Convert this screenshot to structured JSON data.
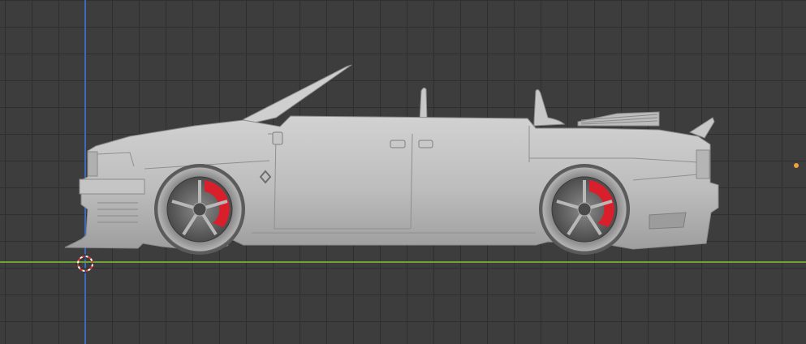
{
  "viewport": {
    "mode": "blender-3d-viewport",
    "grid": true,
    "colors": {
      "background": "#3d3d3d",
      "grid_line": "#2f2f2f",
      "x_axis": "#6fa136",
      "z_axis": "#3e68b8",
      "origin": "#f0a13a",
      "body": "#bdbdbd",
      "brake_caliper": "#d91f2b"
    }
  },
  "scene": {
    "object_icon": "car-model-icon",
    "cursor_icon": "3d-cursor-icon",
    "origin_icon": "object-origin-icon"
  }
}
